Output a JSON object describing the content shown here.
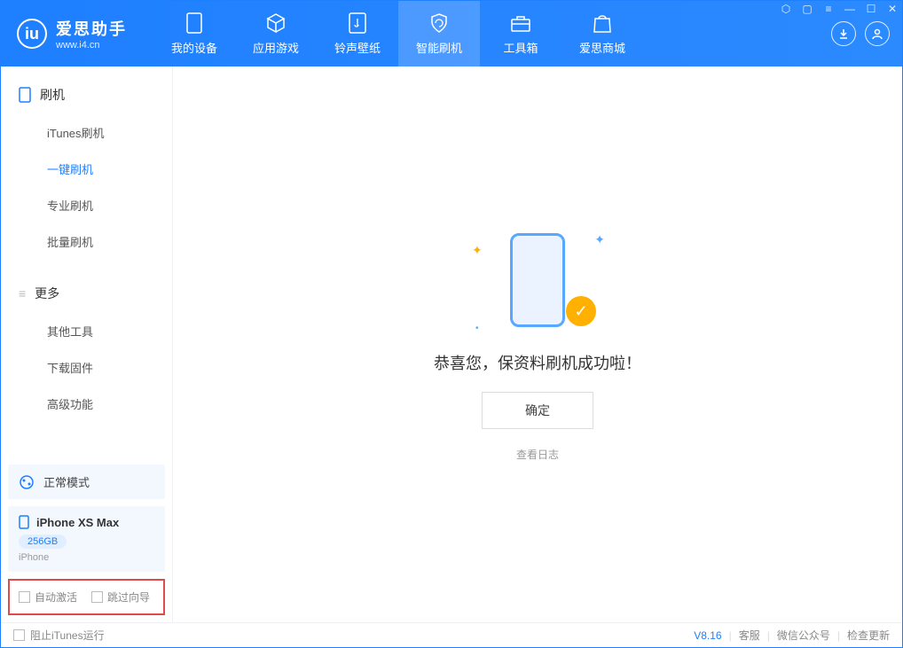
{
  "app": {
    "name": "爱思助手",
    "url": "www.i4.cn"
  },
  "tabs": [
    {
      "label": "我的设备"
    },
    {
      "label": "应用游戏"
    },
    {
      "label": "铃声壁纸"
    },
    {
      "label": "智能刷机"
    },
    {
      "label": "工具箱"
    },
    {
      "label": "爱思商城"
    }
  ],
  "sidebar": {
    "section1": {
      "title": "刷机",
      "items": [
        "iTunes刷机",
        "一键刷机",
        "专业刷机",
        "批量刷机"
      ]
    },
    "section2": {
      "title": "更多",
      "items": [
        "其他工具",
        "下载固件",
        "高级功能"
      ]
    }
  },
  "status": {
    "mode": "正常模式"
  },
  "device": {
    "name": "iPhone XS Max",
    "storage": "256GB",
    "type": "iPhone"
  },
  "options": {
    "autoActivate": "自动激活",
    "skipGuide": "跳过向导"
  },
  "main": {
    "success": "恭喜您，保资料刷机成功啦！",
    "ok": "确定",
    "viewLog": "查看日志"
  },
  "footer": {
    "blockItunes": "阻止iTunes运行",
    "version": "V8.16",
    "support": "客服",
    "wechat": "微信公众号",
    "update": "检查更新"
  }
}
